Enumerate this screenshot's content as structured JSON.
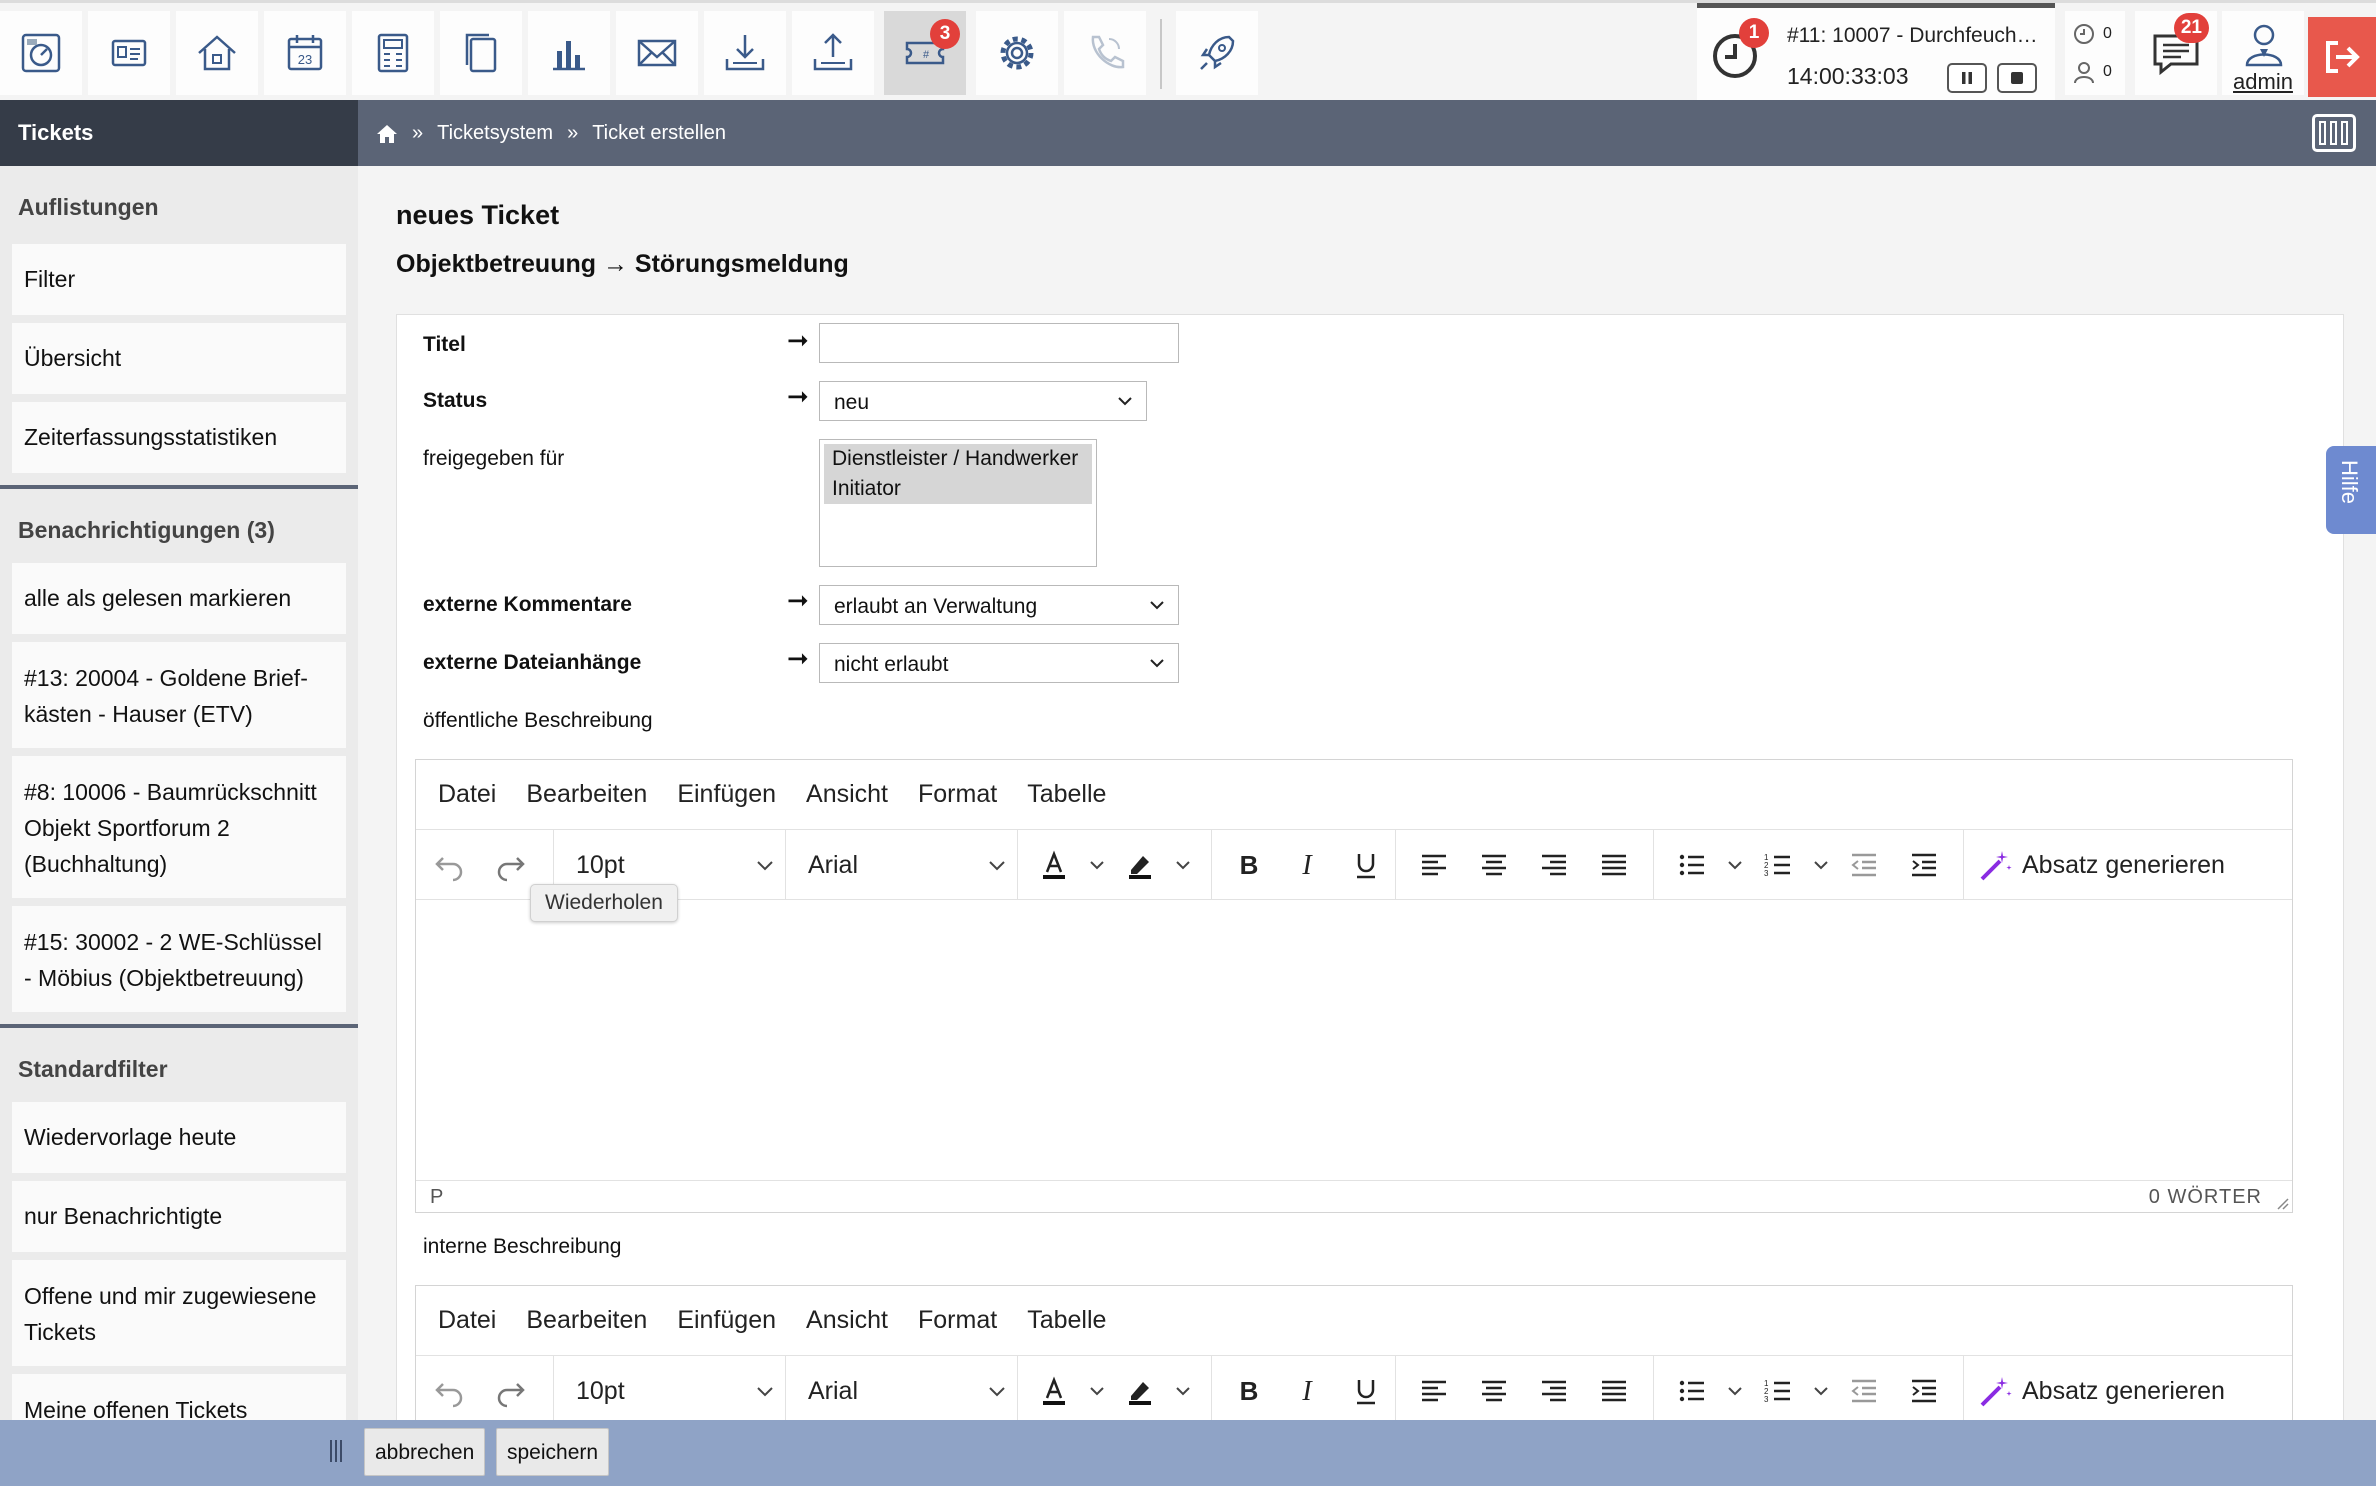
{
  "toolbar": {
    "icons": [
      "dashboard-icon",
      "contacts-icon",
      "property-icon",
      "calendar-icon",
      "accounting-icon",
      "documents-icon",
      "statistics-icon",
      "mail-icon",
      "download-icon",
      "upload-icon",
      "tickets-icon",
      "settings-icon",
      "phone-icon",
      "rocket-icon"
    ],
    "calendar_day": "23",
    "tickets_badge": "3",
    "timer": {
      "badge": "1",
      "title": "#11: 10007 - Durchfeucht…",
      "time": "14:00:33:03"
    },
    "mini_counts": [
      "0",
      "0"
    ],
    "messages_badge": "21",
    "user_label": "admin",
    "accent_color": "#e8584c"
  },
  "subheader": {
    "section": "Tickets",
    "breadcrumb": {
      "sep": "»",
      "level1": "Ticketsystem",
      "level2": "Ticket erstellen"
    }
  },
  "sidebar": {
    "group1": {
      "title": "Auflistungen",
      "items": [
        "Filter",
        "Übersicht",
        "Zeiterfassungsstatistiken"
      ]
    },
    "group2": {
      "title": "Benachrichtigungen (3)",
      "items": [
        "alle als gelesen markieren",
        "#13: 20004 - Goldene Brief­kästen - Hauser (ETV)",
        "#8: 10006 - Baumrückschnitt Objekt Sportforum 2 (Buchhaltung)",
        "#15: 30002 - 2 WE-Schlüssel - Möbius (Objektbetreuung)"
      ]
    },
    "group3": {
      "title": "Standardfilter",
      "items": [
        "Wiedervorlage heute",
        "nur Benachrichtigte",
        "Offene und mir zugewiesene Tickets",
        "Meine offenen Tickets"
      ]
    }
  },
  "page": {
    "title": "neues Ticket",
    "subtitle": "Objektbetreuung → Störungsmeldung"
  },
  "form": {
    "arrow": "➞",
    "titel": {
      "label": "Titel",
      "value": ""
    },
    "status": {
      "label": "Status",
      "value": "neu"
    },
    "freigegeben": {
      "label": "freigegeben für",
      "options": [
        "Dienstleister / Handwerker",
        "Initiator"
      ]
    },
    "ext_kommentare": {
      "label": "externe Kommentare",
      "value": "erlaubt an Verwaltung"
    },
    "ext_anhaenge": {
      "label": "externe Dateianhänge",
      "value": "nicht erlaubt"
    },
    "oeffentlich_label": "öffentliche Beschreibung",
    "intern_label": "interne Beschreibung"
  },
  "editor": {
    "menu": [
      "Datei",
      "Bearbeiten",
      "Einfügen",
      "Ansicht",
      "Format",
      "Tabelle"
    ],
    "font_size": "10pt",
    "font_family": "Arial",
    "absatz_label": "Absatz generieren",
    "status_path": "P",
    "word_count": "0 WÖRTER",
    "tooltip": "Wiederholen"
  },
  "help_tab": "Hilfe",
  "footer": {
    "cancel": "abbrechen",
    "save": "speichern"
  }
}
